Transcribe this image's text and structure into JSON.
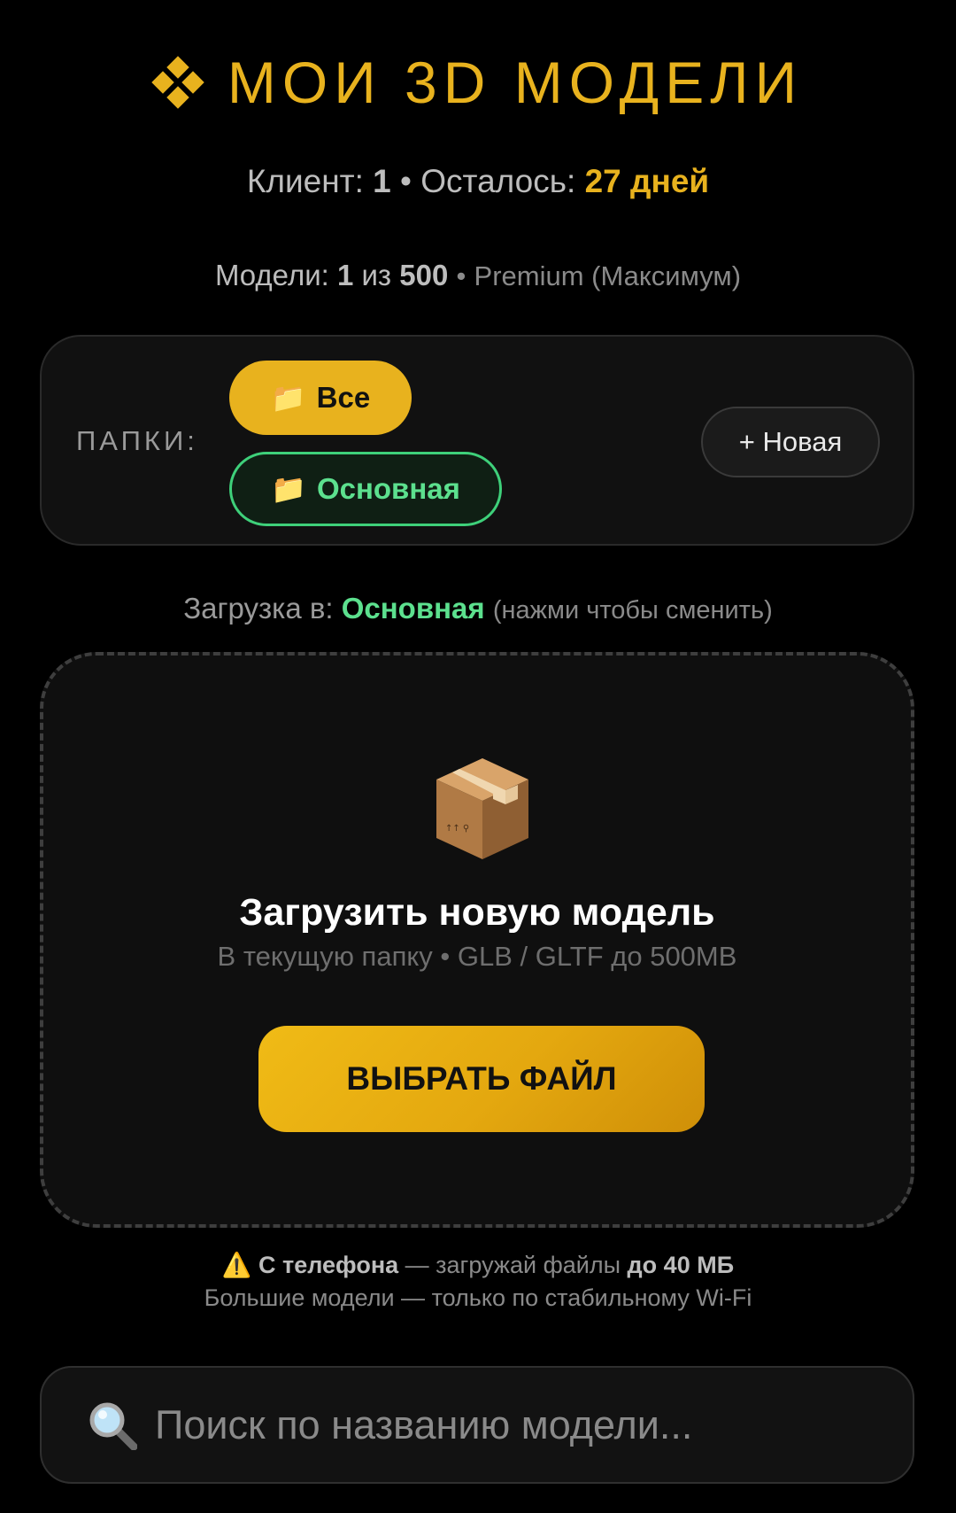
{
  "header": {
    "title": "МОИ 3D МОДЕЛИ",
    "accent": "#e8b21e"
  },
  "status": {
    "client_label": "Клиент:",
    "client_value": "1",
    "separator": "•",
    "remaining_label": "Осталось:",
    "remaining_value": "27 дней"
  },
  "models": {
    "label": "Модели:",
    "count": "1",
    "of": "из",
    "limit": "500",
    "separator": "•",
    "plan": "Premium (Максимум)"
  },
  "folders": {
    "label": "ПАПКИ:",
    "items": [
      {
        "label": "Все",
        "icon": "folder-icon",
        "active": true
      },
      {
        "label": "Основная",
        "icon": "folder-icon",
        "selected": true
      }
    ],
    "new_button": "+ Новая"
  },
  "upload_target": {
    "label": "Загрузка в:",
    "folder": "Основная",
    "hint": "(нажми чтобы сменить)"
  },
  "dropzone": {
    "icon": "package-icon",
    "title": "Загрузить новую модель",
    "subtitle": "В текущую папку • GLB / GLTF до 500MB",
    "button": "ВЫБРАТЬ ФАЙЛ"
  },
  "warning": {
    "icon": "warning-icon",
    "bold1": "С телефона",
    "text1": " — загружай файлы ",
    "bold2": "до 40 МБ",
    "line2": "Большие модели — только по стабильному Wi-Fi"
  },
  "search": {
    "icon": "magnifier-icon",
    "placeholder": "Поиск по названию модели..."
  },
  "colors": {
    "gold": "#e8b21e",
    "green": "#5ce08e",
    "background": "#000000"
  }
}
